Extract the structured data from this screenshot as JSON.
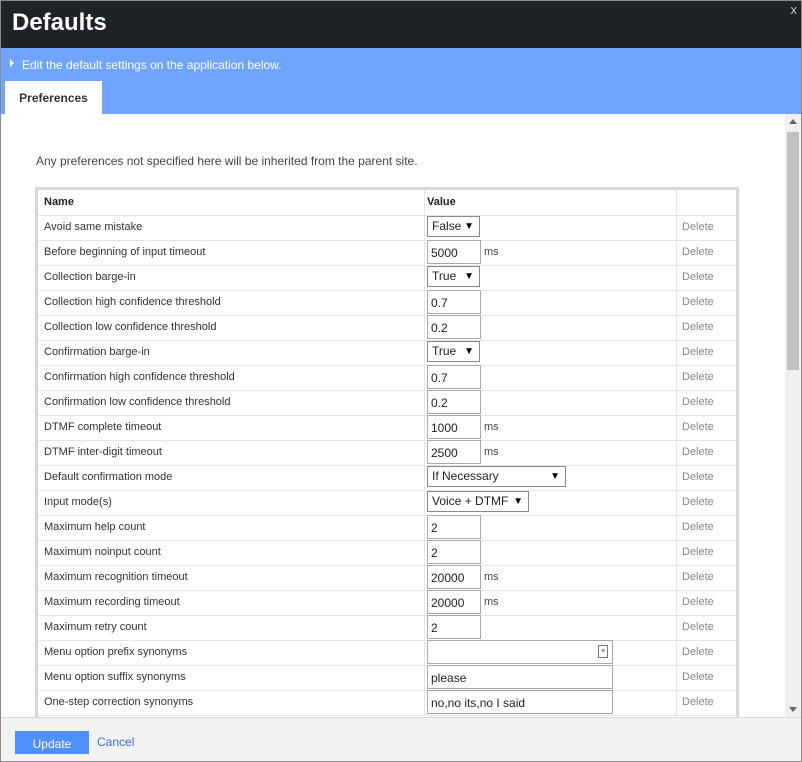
{
  "dialog": {
    "title": "Defaults",
    "close_glyph": "x",
    "info_text": "Edit the default settings on the application below.",
    "tab_label": "Preferences",
    "note": "Any preferences not specified here will be inherited from the parent site."
  },
  "table": {
    "headers": {
      "name": "Name",
      "value": "Value"
    },
    "delete_label": "Delete",
    "rows": [
      {
        "name": "Avoid same mistake",
        "type": "select",
        "value": "False",
        "width": "short"
      },
      {
        "name": "Before beginning of input timeout",
        "type": "input",
        "value": "5000",
        "unit": "ms"
      },
      {
        "name": "Collection barge-in",
        "type": "select",
        "value": "True",
        "width": "short"
      },
      {
        "name": "Collection high confidence threshold",
        "type": "input",
        "value": "0.7"
      },
      {
        "name": "Collection low confidence threshold",
        "type": "input",
        "value": "0.2"
      },
      {
        "name": "Confirmation barge-in",
        "type": "select",
        "value": "True",
        "width": "short"
      },
      {
        "name": "Confirmation high confidence threshold",
        "type": "input",
        "value": "0.7"
      },
      {
        "name": "Confirmation low confidence threshold",
        "type": "input",
        "value": "0.2"
      },
      {
        "name": "DTMF complete timeout",
        "type": "input",
        "value": "1000",
        "unit": "ms"
      },
      {
        "name": "DTMF inter-digit timeout",
        "type": "input",
        "value": "2500",
        "unit": "ms"
      },
      {
        "name": "Default confirmation mode",
        "type": "select",
        "value": "If Necessary",
        "width": "wide"
      },
      {
        "name": "Input mode(s)",
        "type": "select",
        "value": "Voice + DTMF",
        "width": "medium"
      },
      {
        "name": "Maximum help count",
        "type": "input",
        "value": "2"
      },
      {
        "name": "Maximum noinput count",
        "type": "input",
        "value": "2"
      },
      {
        "name": "Maximum recognition timeout",
        "type": "input",
        "value": "20000",
        "unit": "ms"
      },
      {
        "name": "Maximum recording timeout",
        "type": "input",
        "value": "20000",
        "unit": "ms"
      },
      {
        "name": "Maximum retry count",
        "type": "input",
        "value": "2"
      },
      {
        "name": "Menu option prefix synonyms",
        "type": "input-picker",
        "value": ""
      },
      {
        "name": "Menu option suffix synonyms",
        "type": "input-long",
        "value": "please"
      },
      {
        "name": "One-step correction synonyms",
        "type": "input-long",
        "value": "no,no its,no I said"
      }
    ]
  },
  "footer": {
    "update_label": "Update",
    "cancel_label": "Cancel"
  },
  "colors": {
    "titlebar": "#1f2226",
    "infobar": "#6fa5ff",
    "primary_button": "#4d90fe",
    "link": "#3b6fd6"
  },
  "icons": {
    "expand": "triangle-right-icon",
    "close": "close-icon",
    "dropdown": "caret-down-icon",
    "picker": "list-picker-icon"
  }
}
